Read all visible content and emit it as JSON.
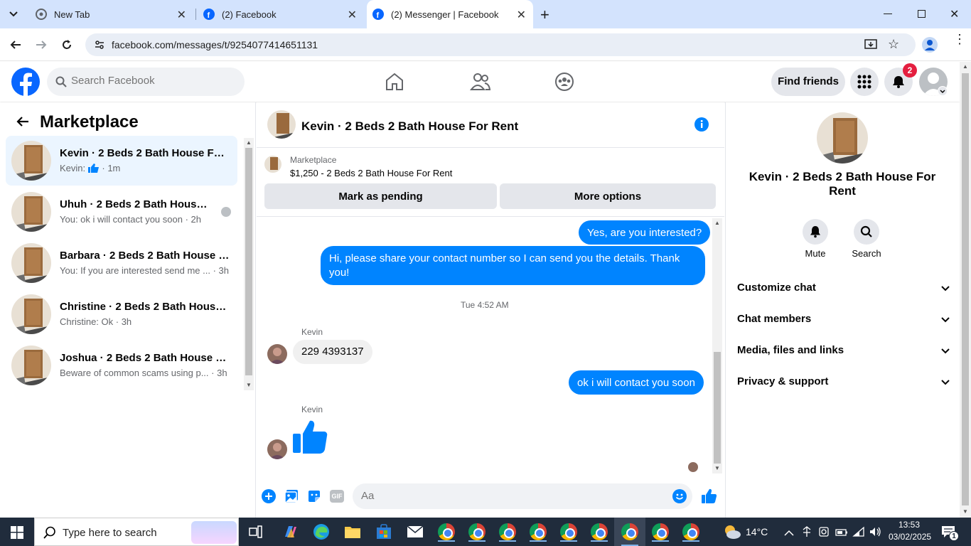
{
  "browser": {
    "tabs": [
      {
        "title": "New Tab"
      },
      {
        "title": "(2) Facebook"
      },
      {
        "title": "(2) Messenger | Facebook"
      }
    ],
    "url": "facebook.com/messages/t/9254077414651131"
  },
  "header": {
    "search_placeholder": "Search Facebook",
    "find_friends": "Find friends",
    "notification_count": "2"
  },
  "left": {
    "title": "Marketplace",
    "conversations": [
      {
        "name": "Kevin · 2 Beds 2 Bath House For Rent",
        "preview_prefix": "Kevin:",
        "time": "1m"
      },
      {
        "name": "Uhuh · 2 Beds 2 Bath House For Rent",
        "preview": "You: ok i will contact you soon",
        "time": "2h"
      },
      {
        "name": "Barbara · 2 Beds 2 Bath House For Rent",
        "preview": "You: If you are interested send me ...",
        "time": "3h"
      },
      {
        "name": "Christine · 2 Beds 2 Bath House For Rent",
        "preview": "Christine: Ok",
        "time": "3h"
      },
      {
        "name": "Joshua · 2 Beds 2 Bath House For Rent",
        "preview": "Beware of common scams using p...",
        "time": "3h"
      }
    ]
  },
  "chat": {
    "title": "Kevin · 2 Beds 2 Bath House For Rent",
    "listing_label": "Marketplace",
    "listing_detail": "$1,250 - 2 Beds 2 Bath House For Rent",
    "mark_pending": "Mark as pending",
    "more_options": "More options",
    "messages": {
      "out1": "Yes, are you interested?",
      "out2": "Hi, please share your contact number so I can send you the details. Thank you!",
      "timestamp": "Tue 4:52 AM",
      "sender1": "Kevin",
      "in1": "229 4393137",
      "out3": "ok i will contact you soon",
      "sender2": "Kevin"
    },
    "composer_placeholder": "Aa"
  },
  "right": {
    "name": "Kevin · 2 Beds 2 Bath House For Rent",
    "mute": "Mute",
    "search": "Search",
    "sections": [
      "Customize chat",
      "Chat members",
      "Media, files and links",
      "Privacy & support"
    ]
  },
  "taskbar": {
    "search_placeholder": "Type here to search",
    "temperature": "14°C",
    "time": "13:53",
    "date": "03/02/2025",
    "notif_count": "1"
  },
  "colors": {
    "accent": "#0084ff",
    "fb_blue": "#0866ff",
    "badge": "#e41e3f"
  }
}
